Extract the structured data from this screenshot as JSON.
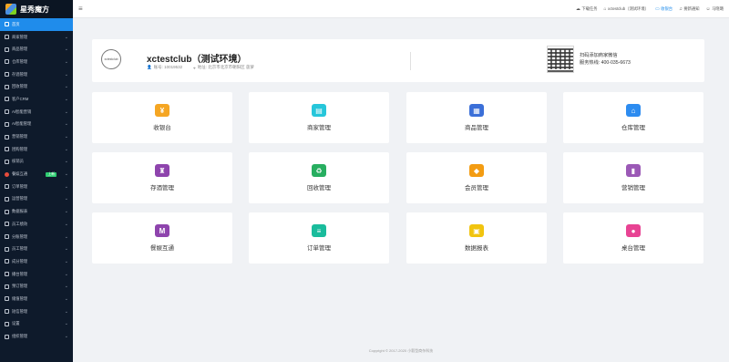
{
  "app": {
    "name": "星秀魔方"
  },
  "sidebar": {
    "items": [
      {
        "label": "首页",
        "active": true
      },
      {
        "label": "商家管理"
      },
      {
        "label": "商品管理"
      },
      {
        "label": "仓库管理"
      },
      {
        "label": "存酒管理"
      },
      {
        "label": "回收管理"
      },
      {
        "label": "客户CRM"
      },
      {
        "label": "AI智能营销"
      },
      {
        "label": "AI智能管理"
      },
      {
        "label": "营销管理"
      },
      {
        "label": "团购管理"
      },
      {
        "label": "核销员"
      },
      {
        "label": "餐娱互通",
        "badge": "上新"
      },
      {
        "label": "订单管理"
      },
      {
        "label": "运营管理"
      },
      {
        "label": "数据报表"
      },
      {
        "label": "员工绩效"
      },
      {
        "label": "分账管理"
      },
      {
        "label": "员工管理"
      },
      {
        "label": "成分管理"
      },
      {
        "label": "播台管理"
      },
      {
        "label": "预订管理"
      },
      {
        "label": "储值管理"
      },
      {
        "label": "短信管理"
      },
      {
        "label": "设置"
      },
      {
        "label": "组织管理"
      }
    ]
  },
  "topbar": {
    "download": "下载任务",
    "account": "xctestclub（测试环境）",
    "cashier": "收银台",
    "message": "要新通知",
    "user": "马晓璐"
  },
  "store": {
    "avatar_text": "xctestclub",
    "name": "xctestclub（测试环境）",
    "account": "账号: 10019532",
    "address": "地址: 北京市北京市朝阳区 菠萝",
    "scan_text": "扫码添加商家微信",
    "service_phone": "服务热线: 400-035-6673"
  },
  "tiles": [
    {
      "label": "收银台",
      "icon": "cashier-icon",
      "color": "#f5a623"
    },
    {
      "label": "商家管理",
      "icon": "store-icon",
      "color": "#26c6da"
    },
    {
      "label": "商品管理",
      "icon": "goods-icon",
      "color": "#3b6fd8"
    },
    {
      "label": "仓库管理",
      "icon": "warehouse-icon",
      "color": "#2d8cf0"
    },
    {
      "label": "存酒管理",
      "icon": "wine-icon",
      "color": "#8e44ad"
    },
    {
      "label": "回收管理",
      "icon": "recycle-icon",
      "color": "#27ae60"
    },
    {
      "label": "会员管理",
      "icon": "member-icon",
      "color": "#f39c12"
    },
    {
      "label": "营销管理",
      "icon": "marketing-icon",
      "color": "#9b59b6"
    },
    {
      "label": "餐娱互通",
      "icon": "dining-icon",
      "color": "#8e44ad"
    },
    {
      "label": "订单管理",
      "icon": "order-icon",
      "color": "#1abc9c"
    },
    {
      "label": "数据报表",
      "icon": "report-icon",
      "color": "#f1c40f"
    },
    {
      "label": "桌台管理",
      "icon": "table-icon",
      "color": "#e84393"
    }
  ],
  "footer": "Copyright © 2017-2020 小毅型商杂科技"
}
